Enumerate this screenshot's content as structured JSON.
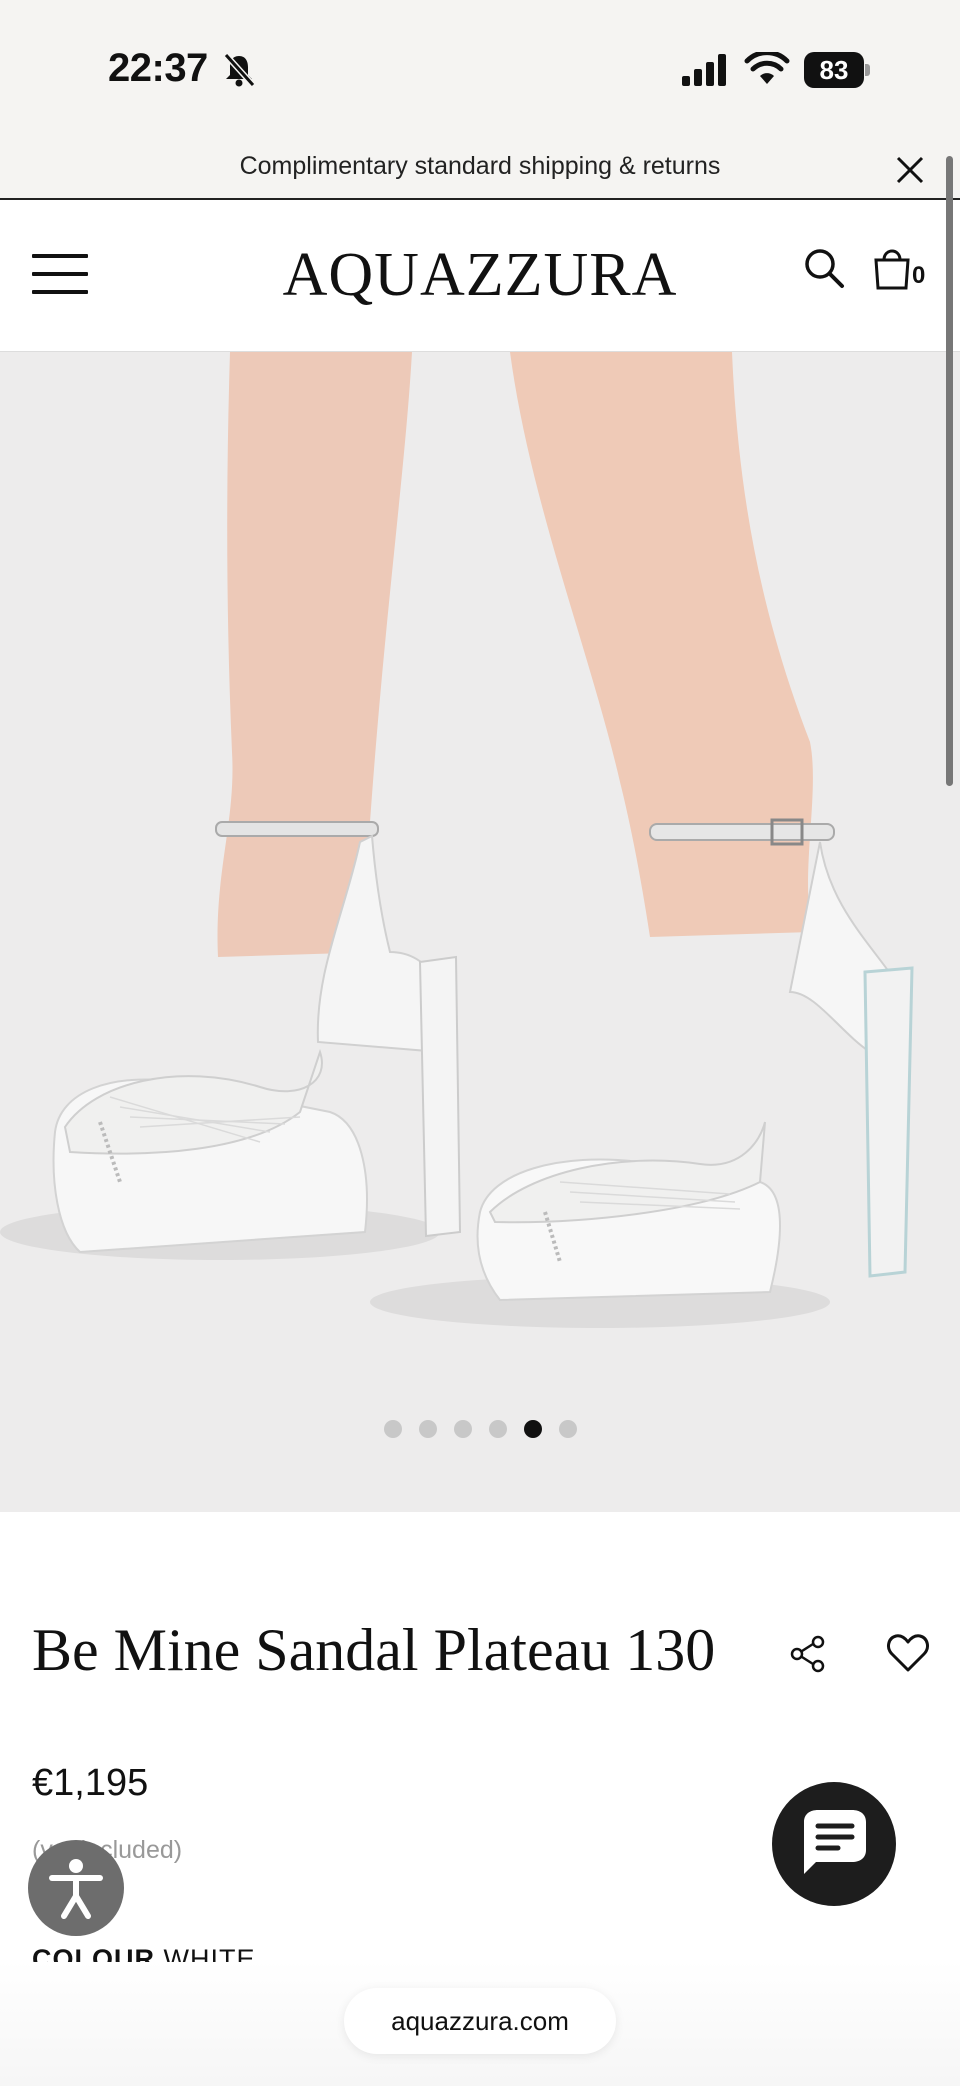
{
  "status_bar": {
    "time": "22:37",
    "battery": "83",
    "icons": [
      "bell-muted-icon",
      "cellular-signal-icon",
      "wifi-icon",
      "battery-icon"
    ]
  },
  "promo": {
    "text": "Complimentary standard shipping & returns",
    "close_icon": "close-icon"
  },
  "header": {
    "logo": "AQUAZZURA",
    "bag_count": "0",
    "icons": [
      "hamburger-menu-icon",
      "search-icon",
      "shopping-bag-icon"
    ]
  },
  "gallery": {
    "image_alt": "white platform sandals on model",
    "slide_count": 6,
    "active_slide": 5
  },
  "product": {
    "title": "Be Mine Sandal Plateau 130",
    "price": "€1,195",
    "vat_note": "(vat included)",
    "colour_label": "COLOUR",
    "colour_value": "WHITE"
  },
  "floating": {
    "accessibility_icon": "accessibility-icon",
    "chat_icon": "chat-icon"
  },
  "browser": {
    "url": "aquazzura.com"
  },
  "colors": {
    "status_bg": "#f5f4f2",
    "hero_bg": "#edecec",
    "text": "#111111",
    "chat_bg": "#1d1d1d",
    "access_bg": "#6d6d6d"
  }
}
